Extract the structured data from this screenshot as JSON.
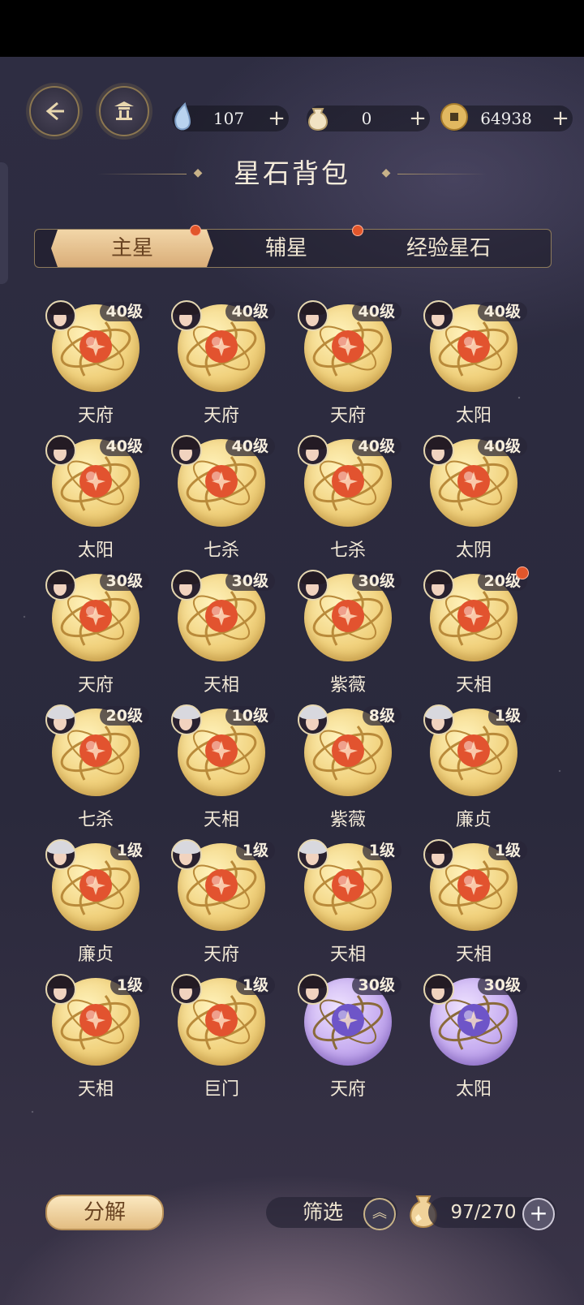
{
  "header": {
    "back_icon": "back-arrow-icon",
    "pavilion_icon": "pavilion-icon",
    "resources": [
      {
        "icon": "water-drop-icon",
        "value": "107",
        "plus": "+"
      },
      {
        "icon": "pouch-icon",
        "value": "0",
        "plus": "+"
      },
      {
        "icon": "coin-icon",
        "value": "64938",
        "plus": "+"
      }
    ]
  },
  "page_title": "星石背包",
  "tabs": [
    {
      "label": "主星",
      "active": true,
      "dot": true
    },
    {
      "label": "辅星",
      "active": false,
      "dot": true
    },
    {
      "label": "经验星石",
      "active": false,
      "dot": false
    }
  ],
  "items": [
    {
      "level": "40级",
      "name": "天府",
      "color": "gold",
      "dot": false
    },
    {
      "level": "40级",
      "name": "天府",
      "color": "gold",
      "dot": false
    },
    {
      "level": "40级",
      "name": "天府",
      "color": "gold",
      "dot": false
    },
    {
      "level": "40级",
      "name": "太阳",
      "color": "gold",
      "dot": false
    },
    {
      "level": "40级",
      "name": "太阳",
      "color": "gold",
      "dot": false
    },
    {
      "level": "40级",
      "name": "七杀",
      "color": "gold",
      "dot": false
    },
    {
      "level": "40级",
      "name": "七杀",
      "color": "gold",
      "dot": false
    },
    {
      "level": "40级",
      "name": "太阴",
      "color": "gold",
      "dot": false
    },
    {
      "level": "30级",
      "name": "天府",
      "color": "gold",
      "dot": false
    },
    {
      "level": "30级",
      "name": "天相",
      "color": "gold",
      "dot": false
    },
    {
      "level": "30级",
      "name": "紫薇",
      "color": "gold",
      "dot": false
    },
    {
      "level": "20级",
      "name": "天相",
      "color": "gold",
      "dot": true
    },
    {
      "level": "20级",
      "name": "七杀",
      "color": "gold",
      "dot": false
    },
    {
      "level": "10级",
      "name": "天相",
      "color": "gold",
      "dot": false
    },
    {
      "level": "8级",
      "name": "紫薇",
      "color": "gold",
      "dot": false
    },
    {
      "level": "1级",
      "name": "廉贞",
      "color": "gold",
      "dot": false
    },
    {
      "level": "1级",
      "name": "廉贞",
      "color": "gold",
      "dot": false
    },
    {
      "level": "1级",
      "name": "天府",
      "color": "gold",
      "dot": false
    },
    {
      "level": "1级",
      "name": "天相",
      "color": "gold",
      "dot": false
    },
    {
      "level": "1级",
      "name": "天相",
      "color": "gold",
      "dot": false
    },
    {
      "level": "1级",
      "name": "天相",
      "color": "gold",
      "dot": false
    },
    {
      "level": "1级",
      "name": "巨门",
      "color": "gold",
      "dot": false
    },
    {
      "level": "30级",
      "name": "天府",
      "color": "purple",
      "dot": false
    },
    {
      "level": "30级",
      "name": "太阳",
      "color": "purple",
      "dot": false
    }
  ],
  "footer": {
    "decompose_label": "分解",
    "filter_label": "筛选",
    "filter_icon": "double-chevron-up-icon",
    "capacity": "97/270",
    "capacity_icon": "bag-icon",
    "capacity_plus": "+"
  },
  "colors": {
    "accent_gold": "#e3bd82",
    "notification_red": "#e2562b",
    "background": "#2b2a3d"
  }
}
